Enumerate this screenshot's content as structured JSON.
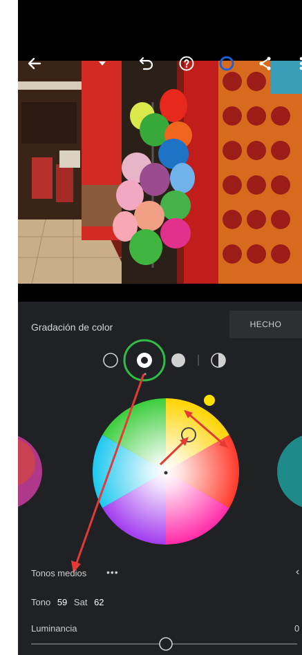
{
  "toolbar": {
    "back_icon": "arrow-left-icon",
    "dropdown_icon": "caret-down-icon",
    "undo_icon": "undo-icon",
    "help_icon": "help-icon",
    "color_mode_icon": "ring-icon",
    "share_icon": "share-icon",
    "more_icon": "more-vertical-icon"
  },
  "panel": {
    "title": "Gradación de color",
    "done_label": "HECHO",
    "selected_mode": "midtones",
    "modes": [
      "shadows",
      "midtones",
      "highlights",
      "global"
    ]
  },
  "wheel": {
    "region_label": "Tonos medios",
    "more_label": "•••",
    "hue_label": "Tono",
    "hue_value": "59",
    "sat_label": "Sat",
    "sat_value": "62",
    "luminance_label": "Luminancia",
    "luminance_value": "0"
  },
  "colors": {
    "panel_bg": "#1f2124",
    "annotation_red": "#e53935",
    "annotation_green": "#2fbf47",
    "hue_dot": "#ffe100"
  }
}
